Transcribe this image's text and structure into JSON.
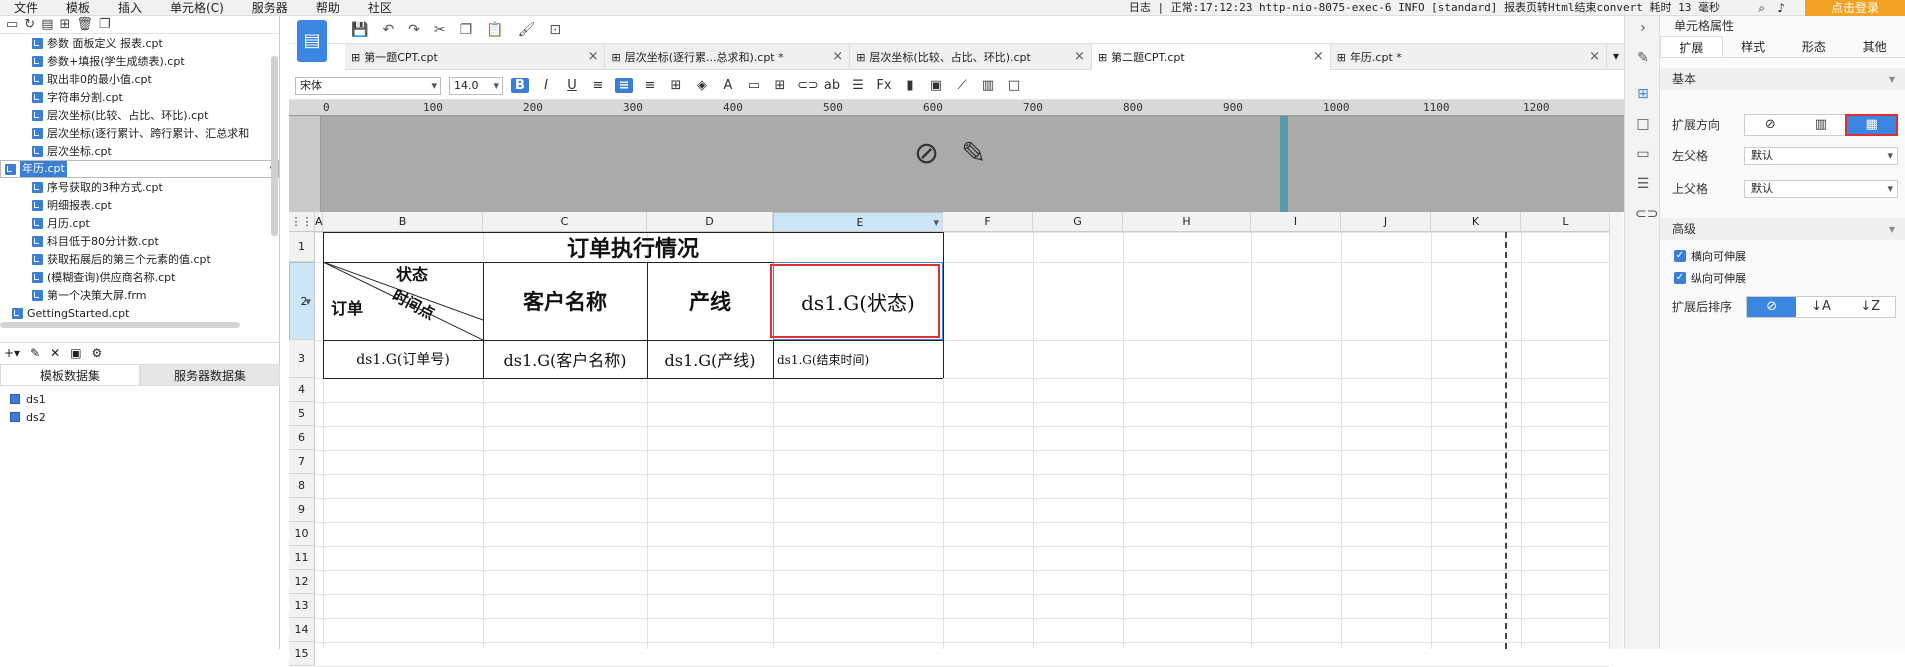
{
  "menubar": {
    "items": [
      "文件",
      "模板",
      "插入",
      "单元格(C)",
      "服务器",
      "帮助",
      "社区"
    ],
    "status": "日志 | 正常:17:12:23 http-nio-8075-exec-6 INFO [standard] 报表页转Html结束convert  耗时 13 毫秒",
    "login": "点击登录"
  },
  "tree": {
    "items": [
      {
        "label": "参数 面板定义 报表.cpt",
        "selected": false
      },
      {
        "label": "参数+填报(学生成绩表).cpt",
        "selected": false
      },
      {
        "label": "取出非0的最小值.cpt",
        "selected": false
      },
      {
        "label": "字符串分割.cpt",
        "selected": false
      },
      {
        "label": "层次坐标(比较、占比、环比).cpt",
        "selected": false
      },
      {
        "label": "层次坐标(逐行累计、跨行累计、汇总求和",
        "selected": false
      },
      {
        "label": "层次坐标.cpt",
        "selected": false
      },
      {
        "label": "年历.cpt",
        "selected": true
      },
      {
        "label": "序号获取的3种方式.cpt",
        "selected": false
      },
      {
        "label": "明细报表.cpt",
        "selected": false
      },
      {
        "label": "月历.cpt",
        "selected": false
      },
      {
        "label": "科目低于80分计数.cpt",
        "selected": false
      },
      {
        "label": "获取拓展后的第三个元素的值.cpt",
        "selected": false
      },
      {
        "label": "(模糊查询)供应商名称.cpt",
        "selected": false
      },
      {
        "label": "第一个决策大屏.frm",
        "selected": false
      }
    ],
    "root": "GettingStarted.cpt"
  },
  "datasets": {
    "tabs": [
      "模板数据集",
      "服务器数据集"
    ],
    "items": [
      "ds1",
      "ds2"
    ]
  },
  "filetabs": [
    {
      "label": "第一题CPT.cpt",
      "active": false
    },
    {
      "label": "层次坐标(逐行累...总求和).cpt *",
      "active": false
    },
    {
      "label": "层次坐标(比较、占比、环比).cpt",
      "active": false
    },
    {
      "label": "第二题CPT.cpt",
      "active": true
    },
    {
      "label": "年历.cpt *",
      "active": false
    }
  ],
  "format": {
    "font": "宋体",
    "size": "14.0"
  },
  "ruler": [
    "0",
    "100",
    "200",
    "300",
    "400",
    "500",
    "600",
    "700",
    "800",
    "900",
    "1000",
    "1100",
    "1200"
  ],
  "columns": [
    "A",
    "B",
    "C",
    "D",
    "E",
    "F",
    "G",
    "H",
    "I",
    "J",
    "K",
    "L"
  ],
  "rows": [
    "1",
    "2",
    "3",
    "4",
    "5",
    "6",
    "7",
    "8",
    "9",
    "10",
    "11",
    "12",
    "13",
    "14",
    "15"
  ],
  "report": {
    "title": "订单执行情况",
    "slash_status": "状态",
    "slash_time": "时间点",
    "slash_order": "订单",
    "h_customer": "客户名称",
    "h_line": "产线",
    "h_state": "ds1.G(状态)",
    "r_order": "ds1.G(订单号)",
    "r_customer": "ds1.G(客户名称)",
    "r_line": "ds1.G(产线)",
    "r_end": "ds1.G(结束时间)"
  },
  "panel": {
    "title": "单元格属性",
    "tabs": [
      "扩展",
      "样式",
      "形态",
      "其他"
    ],
    "basic": "基本",
    "expand_dir": "扩展方向",
    "left_parent": "左父格",
    "left_value": "默认",
    "up_parent": "上父格",
    "up_value": "默认",
    "advanced": "高级",
    "h_expand": "横向可伸展",
    "v_expand": "纵向可伸展",
    "sort": "扩展后排序"
  },
  "colors": {
    "accent": "#3b86e0",
    "highlight": "#e03030",
    "login": "#f2a222"
  }
}
